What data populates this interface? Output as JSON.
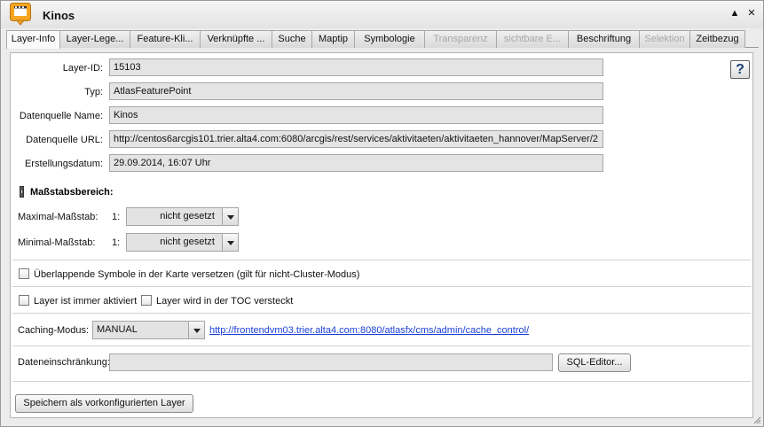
{
  "window": {
    "title": "Kinos",
    "icon": "cinema-layer-icon",
    "minimize_glyph": "▲",
    "close_glyph": "✕"
  },
  "tabs": [
    {
      "label": "Layer-Info",
      "active": true,
      "disabled": false
    },
    {
      "label": "Layer-Lege...",
      "active": false,
      "disabled": false
    },
    {
      "label": "Feature-Kli...",
      "active": false,
      "disabled": false
    },
    {
      "label": "Verknüpfte ...",
      "active": false,
      "disabled": false
    },
    {
      "label": "Suche",
      "active": false,
      "disabled": false
    },
    {
      "label": "Maptip",
      "active": false,
      "disabled": false
    },
    {
      "label": "Symbologie",
      "active": false,
      "disabled": false
    },
    {
      "label": "Transparenz",
      "active": false,
      "disabled": true
    },
    {
      "label": "sichtbare E...",
      "active": false,
      "disabled": true
    },
    {
      "label": "Beschriftung",
      "active": false,
      "disabled": false
    },
    {
      "label": "Selektion",
      "active": false,
      "disabled": true
    },
    {
      "label": "Zeitbezug",
      "active": false,
      "disabled": false
    }
  ],
  "help_glyph": "?",
  "info": {
    "layer_id": {
      "label": "Layer-ID:",
      "value": "15103"
    },
    "typ": {
      "label": "Typ:",
      "value": "AtlasFeaturePoint"
    },
    "datasource_name": {
      "label": "Datenquelle Name:",
      "value": "Kinos"
    },
    "datasource_url": {
      "label": "Datenquelle URL:",
      "value": "http://centos6arcgis101.trier.alta4.com:6080/arcgis/rest/services/aktivitaeten/aktivitaeten_hannover/MapServer/2"
    },
    "created": {
      "label": "Erstellungsdatum:",
      "value": "29.09.2014, 16:07 Uhr"
    }
  },
  "scale": {
    "section_title": "Maßstabsbereich:",
    "max": {
      "label": "Maximal-Maßstab:",
      "prefix": "1:",
      "value": "nicht gesetzt"
    },
    "min": {
      "label": "Minimal-Maßstab:",
      "prefix": "1:",
      "value": "nicht gesetzt"
    }
  },
  "options": {
    "overlap_label": "Überlappende Symbole in der Karte versetzen (gilt für nicht-Cluster-Modus)",
    "always_active_label": "Layer ist immer aktiviert",
    "hidden_toc_label": "Layer wird in der TOC versteckt"
  },
  "caching": {
    "label": "Caching-Modus:",
    "value": "MANUAL",
    "link": "http://frontendvm03.trier.alta4.com:8080/atlasfx/cms/admin/cache_control/"
  },
  "restriction": {
    "label": "Dateneinschränkung:",
    "value": "",
    "sql_button": "SQL-Editor..."
  },
  "save_button": "Speichern als vorkonfigurierten Layer"
}
